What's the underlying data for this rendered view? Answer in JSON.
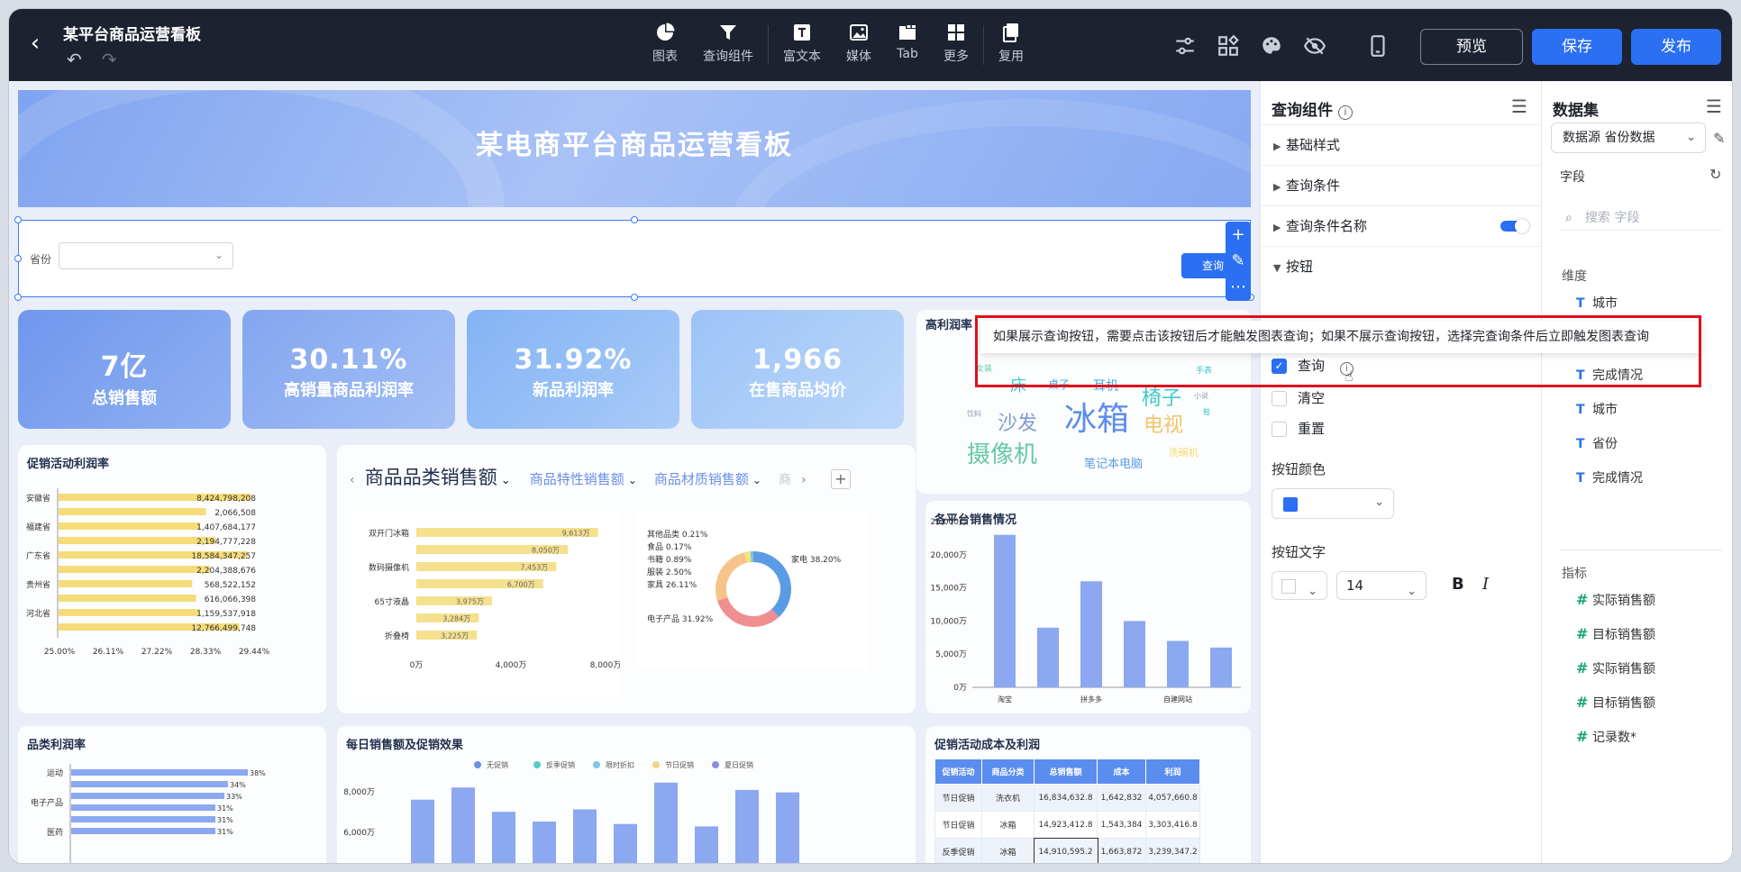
{
  "header": {
    "title": "某平台商品运营看板",
    "tools": [
      {
        "label": "图表",
        "icon": "pie-chart-icon"
      },
      {
        "label": "查询组件",
        "icon": "filter-icon"
      },
      {
        "label": "富文本",
        "icon": "text-icon"
      },
      {
        "label": "媒体",
        "icon": "image-icon"
      },
      {
        "label": "Tab",
        "icon": "tab-icon"
      },
      {
        "label": "更多",
        "icon": "grid-icon"
      },
      {
        "label": "复用",
        "icon": "copy-icon"
      }
    ],
    "preview_label": "预览",
    "save_label": "保存",
    "publish_label": "发布"
  },
  "canvas": {
    "banner_title": "某电商平台商品运营看板",
    "query": {
      "field_label": "省份",
      "button_label": "查询"
    },
    "kpis": [
      {
        "value": "7亿",
        "label": "总销售额"
      },
      {
        "value": "30.11%",
        "label": "高销量商品利润率"
      },
      {
        "value": "31.92%",
        "label": "新品利润率"
      },
      {
        "value": "1,966",
        "label": "在售商品均价"
      }
    ],
    "promo_profit": {
      "title": "促销活动利润率",
      "labels": [
        "安徽省",
        "福建省",
        "广东省",
        "贵州省",
        "河北省"
      ],
      "values": [
        "8,424,798,208",
        "2,066,508",
        "1,407,684,177",
        "2,194,777,228",
        "18,584,347,257",
        "2,204,388,676",
        "568,522,152",
        "616,066,398",
        "1,159,537,918",
        "12,766,499,748"
      ],
      "fill": [
        0.98,
        0.75,
        0.72,
        0.8,
        0.96,
        0.77,
        0.68,
        0.7,
        0.72,
        0.92
      ],
      "x_ticks": [
        "25.00%",
        "26.11%",
        "27.22%",
        "28.33%",
        "29.44%"
      ]
    },
    "category_sales": {
      "tabs": [
        "商品品类销售额",
        "商品特性销售额",
        "商品材质销售额",
        "商"
      ],
      "bar_labels": [
        "双开门冰箱",
        "数码摄像机",
        "65寸液晶",
        "折叠椅"
      ],
      "bar_values": [
        "9,613万",
        "8,050万",
        "7,453万",
        "6,700万",
        "3,975万",
        "3,284万",
        "3,225万"
      ],
      "bar_fill": [
        0.96,
        0.8,
        0.74,
        0.67,
        0.4,
        0.33,
        0.32
      ],
      "x_ticks": [
        "0万",
        "4,000万",
        "8,000万"
      ],
      "donut_labels": [
        {
          "text": "其他品类 0.21%"
        },
        {
          "text": "食品 0.17%"
        },
        {
          "text": "书籍 0.89%"
        },
        {
          "text": "服装 2.50%"
        },
        {
          "text": "家具 26.11%"
        },
        {
          "text": "家电 38.20%"
        },
        {
          "text": "电子产品 31.92%"
        }
      ]
    },
    "wordcloud": {
      "title": "高利润率",
      "words": [
        {
          "text": "冰箱",
          "color": "#5b8def"
        },
        {
          "text": "摄像机",
          "color": "#67c8a6"
        },
        {
          "text": "沙发",
          "color": "#7f9ccf"
        },
        {
          "text": "电视",
          "color": "#f4c26b"
        },
        {
          "text": "椅子",
          "color": "#3ec9c9"
        },
        {
          "text": "床",
          "color": "#3ec9c9"
        },
        {
          "text": "耳机",
          "color": "#4aa3df"
        },
        {
          "text": "桌子",
          "color": "#4aa3df"
        },
        {
          "text": "笔记本电脑",
          "color": "#5b9be0"
        },
        {
          "text": "洗碗机",
          "color": "#f4d86b"
        },
        {
          "text": "手表",
          "color": "#3ec9c9"
        },
        {
          "text": "女装",
          "color": "#67c8a6"
        },
        {
          "text": "饮料",
          "color": "#8a9bb4"
        },
        {
          "text": "小说",
          "color": "#8a9bb4"
        },
        {
          "text": "鞋",
          "color": "#3ec9c9"
        }
      ]
    },
    "platform_sales": {
      "title": "各平台销售情况",
      "y_ticks": [
        "25,000万",
        "20,000万",
        "15,000万",
        "10,000万",
        "5,000万",
        "0万"
      ],
      "x_labels": [
        "淘宝",
        "拼多多",
        "自建网站"
      ],
      "values": [
        23000,
        9000,
        16000,
        10000,
        7000,
        6000
      ]
    },
    "category_profit": {
      "title": "品类利润率",
      "labels": [
        "运动",
        "电子产品",
        "医药"
      ],
      "values": [
        "38%",
        "34%",
        "33%",
        "31%",
        "31%",
        "31%"
      ],
      "fill": [
        0.98,
        0.87,
        0.85,
        0.8,
        0.8,
        0.8
      ]
    },
    "daily_sales": {
      "title": "每日销售额及促销效果",
      "legend": [
        {
          "name": "无促销",
          "color": "#6b8fe6"
        },
        {
          "name": "反季促销",
          "color": "#59c9c2"
        },
        {
          "name": "限时折扣",
          "color": "#7fc7e8"
        },
        {
          "name": "节日促销",
          "color": "#f3d57d"
        },
        {
          "name": "夏日促销",
          "color": "#8a8fe0"
        }
      ],
      "y_ticks": [
        "8,000万",
        "6,000万"
      ],
      "values": [
        6900,
        7400,
        6400,
        6000,
        6500,
        5900,
        7600,
        5800,
        7300,
        7200
      ]
    },
    "promo_cost": {
      "title": "促销活动成本及利润",
      "headers": [
        "促销活动",
        "商品分类",
        "总销售额",
        "成本",
        "利润"
      ],
      "rows": [
        [
          "节日促销",
          "洗衣机",
          "16,834,632.8",
          "1,642,832",
          "4,057,660.8"
        ],
        [
          "节日促销",
          "冰箱",
          "14,923,412.8",
          "1,543,384",
          "3,303,416.8"
        ],
        [
          "反季促销",
          "冰箱",
          "14,910,595.2",
          "1,663,872",
          "3,239,347.2"
        ]
      ]
    }
  },
  "query_panel": {
    "title": "查询组件",
    "sections": [
      "基础样式",
      "查询条件",
      "查询条件名称",
      "按钮"
    ],
    "buttons": [
      {
        "label": "查询",
        "checked": true
      },
      {
        "label": "清空",
        "checked": false
      },
      {
        "label": "重置",
        "checked": false
      }
    ],
    "button_color_label": "按钮颜色",
    "button_color": "#2b6ff2",
    "button_text_label": "按钮文字",
    "font_size": "14",
    "bold_label": "B",
    "italic_label": "I",
    "tooltip": "如果展示查询按钮，需要点击该按钮后才能触发图表查询；如果不展示查询按钮，选择完查询条件后立即触发图表查询"
  },
  "data_panel": {
    "title": "数据集",
    "dataset": "数据源 省份数据",
    "fields_label": "字段",
    "search_placeholder": "搜索 字段",
    "dimension_label": "维度",
    "dimensions": [
      "城市",
      "完成情况",
      "城市",
      "省份",
      "完成情况"
    ],
    "measure_label": "指标",
    "measures": [
      "实际销售额",
      "目标销售额",
      "实际销售额",
      "目标销售额",
      "记录数*"
    ]
  }
}
